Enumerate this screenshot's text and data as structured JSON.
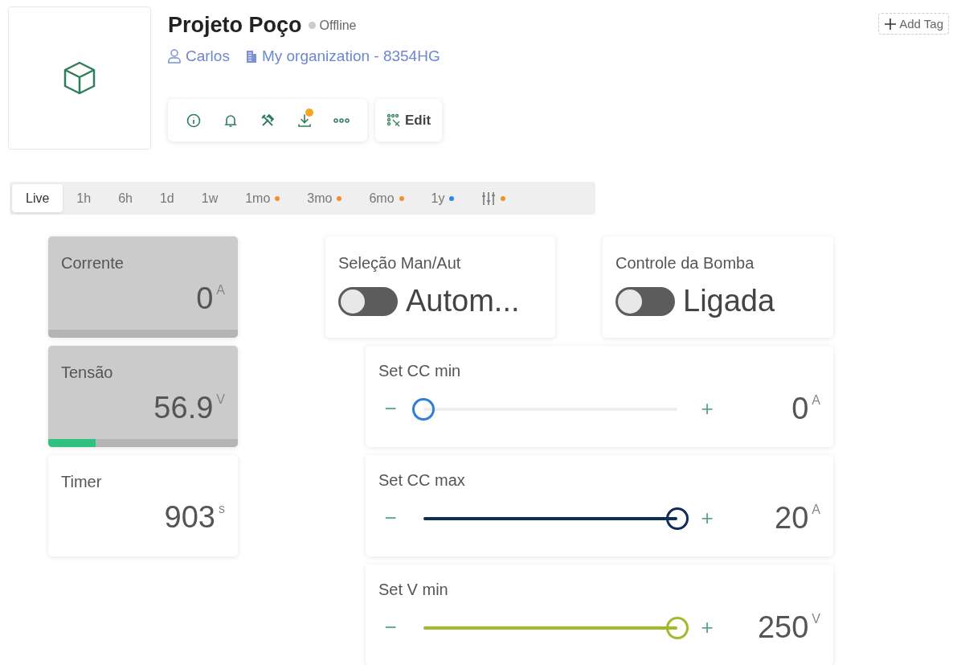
{
  "device": {
    "title": "Projeto Poço",
    "status": "Offline",
    "owner": "Carlos",
    "organization": "My organization - 8354HG"
  },
  "add_tag": "Add Tag",
  "toolbar": [
    {
      "badge": false
    },
    {
      "badge": false
    },
    {
      "badge": false
    },
    {
      "badge": true
    },
    {
      "badge": false
    }
  ],
  "edit_button": "Edit",
  "time_tabs": [
    {
      "kind": "text",
      "label": "Live",
      "selected": true
    },
    {
      "kind": "text",
      "label": "1h",
      "selected": false
    },
    {
      "kind": "text",
      "label": "6h",
      "selected": false
    },
    {
      "kind": "text",
      "label": "1d",
      "selected": false
    },
    {
      "kind": "text",
      "label": "1w",
      "selected": false
    },
    {
      "kind": "text",
      "label": "1mo",
      "selected": false,
      "color": "#f0922b"
    },
    {
      "kind": "text",
      "label": "3mo",
      "selected": false,
      "color": "#f0922b"
    },
    {
      "kind": "text",
      "label": "6mo",
      "selected": false,
      "color": "#f0922b"
    },
    {
      "kind": "text",
      "label": "1y",
      "selected": false,
      "color": "#2f86e8"
    },
    {
      "kind": "icon",
      "selected": false,
      "color": "#f0922b"
    }
  ],
  "metrics": [
    {
      "kind": "gauge",
      "label": "Corrente",
      "value": "0",
      "unit": "A"
    },
    {
      "kind": "gauge",
      "label": "Tensão",
      "value": "56.9",
      "unit": "V",
      "level": 0.25
    },
    {
      "kind": "plain",
      "label": "Timer",
      "value": "903",
      "unit": "s"
    }
  ],
  "switches": [
    {
      "label": "Seleção Man/Aut",
      "value": "Autom...",
      "on": false
    },
    {
      "label": "Controle da Bomba",
      "value": "Ligada",
      "on": false
    }
  ],
  "sliders": [
    {
      "label": "Set CC min",
      "minus": "−",
      "plus": "+",
      "value": "0",
      "unit": "A",
      "level": 0,
      "color": "#2f7fd6"
    },
    {
      "label": "Set CC max",
      "minus": "−",
      "plus": "+",
      "value": "20",
      "unit": "A",
      "level": 1,
      "color": "#0d2f57"
    },
    {
      "label": "Set V min",
      "minus": "−",
      "plus": "+",
      "value": "250",
      "unit": "V",
      "level": 1,
      "color": "#a4b82e"
    }
  ]
}
